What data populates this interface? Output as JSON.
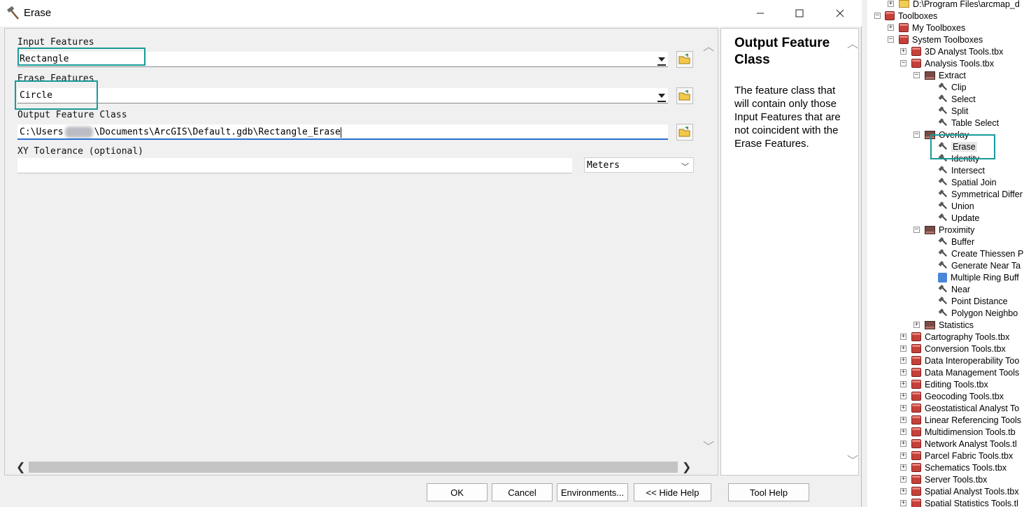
{
  "window": {
    "title": "Erase",
    "min_label": "–",
    "max_label": "☐",
    "close_label": "✕"
  },
  "params": {
    "input_features_label": "Input Features",
    "input_features_value": "Rectangle",
    "erase_features_label": "Erase Features",
    "erase_features_value": "Circle",
    "output_label": "Output Feature Class",
    "output_prefix": "C:\\Users",
    "output_suffix": "\\Documents\\ArcGIS\\Default.gdb\\Rectangle_Erase",
    "xy_label": "XY Tolerance (optional)",
    "xy_value": "",
    "units_value": "Meters"
  },
  "help": {
    "title": "Output Feature Class",
    "body": "The feature class that will contain only those Input Features that are not coincident with the Erase Features."
  },
  "buttons": {
    "ok": "OK",
    "cancel": "Cancel",
    "environments": "Environments...",
    "hide_help": "<< Hide Help",
    "tool_help": "Tool Help"
  },
  "tree": {
    "items": [
      {
        "label": "D:\\Program Files\\arcmap_d",
        "icon": "folder-icon"
      },
      {
        "label": "Toolboxes",
        "icon": "toolbox-icon"
      },
      {
        "label": "My Toolboxes",
        "icon": "folder-toolbox-icon"
      },
      {
        "label": "System Toolboxes",
        "icon": "folder-toolbox-icon"
      },
      {
        "label": "3D Analyst Tools.tbx",
        "icon": "toolbox-icon"
      },
      {
        "label": "Analysis Tools.tbx",
        "icon": "toolbox-icon"
      },
      {
        "label": "Extract",
        "icon": "toolset-icon"
      },
      {
        "label": "Clip",
        "icon": "tool-icon"
      },
      {
        "label": "Select",
        "icon": "tool-icon"
      },
      {
        "label": "Split",
        "icon": "tool-icon"
      },
      {
        "label": "Table Select",
        "icon": "tool-icon"
      },
      {
        "label": "Overlay",
        "icon": "toolset-icon"
      },
      {
        "label": "Erase",
        "icon": "tool-icon"
      },
      {
        "label": "Identity",
        "icon": "tool-icon"
      },
      {
        "label": "Intersect",
        "icon": "tool-icon"
      },
      {
        "label": "Spatial Join",
        "icon": "tool-icon"
      },
      {
        "label": "Symmetrical Differ",
        "icon": "tool-icon"
      },
      {
        "label": "Union",
        "icon": "tool-icon"
      },
      {
        "label": "Update",
        "icon": "tool-icon"
      },
      {
        "label": "Proximity",
        "icon": "toolset-icon"
      },
      {
        "label": "Buffer",
        "icon": "tool-icon"
      },
      {
        "label": "Create Thiessen P",
        "icon": "tool-icon"
      },
      {
        "label": "Generate Near Ta",
        "icon": "tool-icon"
      },
      {
        "label": "Multiple Ring Buff",
        "icon": "script-icon"
      },
      {
        "label": "Near",
        "icon": "tool-icon"
      },
      {
        "label": "Point Distance",
        "icon": "tool-icon"
      },
      {
        "label": "Polygon Neighbo",
        "icon": "tool-icon"
      },
      {
        "label": "Statistics",
        "icon": "toolset-icon"
      },
      {
        "label": "Cartography Tools.tbx",
        "icon": "toolbox-icon"
      },
      {
        "label": "Conversion Tools.tbx",
        "icon": "toolbox-icon"
      },
      {
        "label": "Data Interoperability Too",
        "icon": "toolbox-icon"
      },
      {
        "label": "Data Management Tools",
        "icon": "toolbox-icon"
      },
      {
        "label": "Editing Tools.tbx",
        "icon": "toolbox-icon"
      },
      {
        "label": "Geocoding Tools.tbx",
        "icon": "toolbox-icon"
      },
      {
        "label": "Geostatistical Analyst To",
        "icon": "toolbox-icon"
      },
      {
        "label": "Linear Referencing Tools",
        "icon": "toolbox-icon"
      },
      {
        "label": "Multidimension Tools.tb",
        "icon": "toolbox-icon"
      },
      {
        "label": "Network Analyst Tools.tl",
        "icon": "toolbox-icon"
      },
      {
        "label": "Parcel Fabric Tools.tbx",
        "icon": "toolbox-icon"
      },
      {
        "label": "Schematics Tools.tbx",
        "icon": "toolbox-icon"
      },
      {
        "label": "Server Tools.tbx",
        "icon": "toolbox-icon"
      },
      {
        "label": "Spatial Analyst Tools.tbx",
        "icon": "toolbox-icon"
      },
      {
        "label": "Spatial Statistics Tools.tl",
        "icon": "toolbox-icon"
      }
    ]
  }
}
